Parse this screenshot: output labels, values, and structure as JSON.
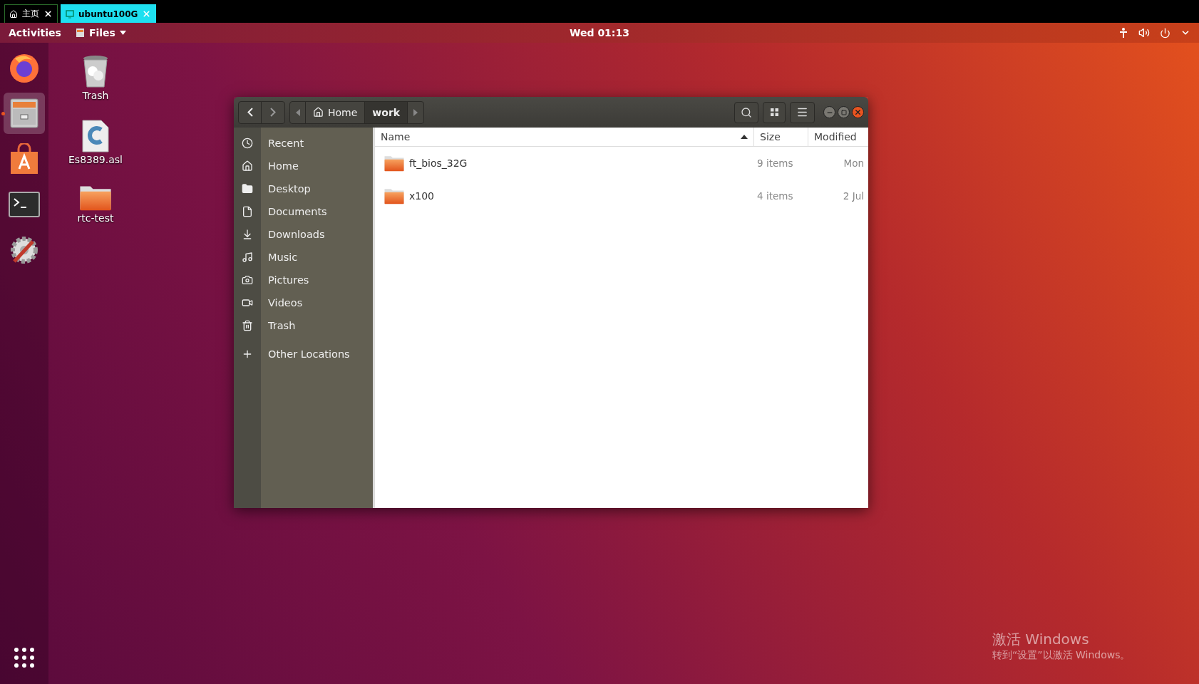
{
  "browser_tabs": [
    {
      "label": "主页",
      "selected": false
    },
    {
      "label": "ubuntu100G",
      "selected": true
    }
  ],
  "top_bar": {
    "activities": "Activities",
    "app_menu": "Files",
    "clock": "Wed 01:13"
  },
  "dock": {
    "items": [
      {
        "kind": "browser",
        "selected": false,
        "running": false
      },
      {
        "kind": "files",
        "selected": true,
        "running": true
      },
      {
        "kind": "software",
        "selected": false,
        "running": false
      },
      {
        "kind": "terminal",
        "selected": false,
        "running": false
      },
      {
        "kind": "settings",
        "selected": false,
        "running": false
      }
    ]
  },
  "desktop_icons": [
    {
      "kind": "trash",
      "label": "Trash"
    },
    {
      "kind": "document",
      "label": "Es8389.asl"
    },
    {
      "kind": "folder",
      "label": "rtc-test"
    }
  ],
  "window": {
    "path": [
      {
        "label": "Home",
        "selected": false
      },
      {
        "label": "work",
        "selected": true
      }
    ],
    "sidebar": {
      "items": [
        {
          "kind": "recent",
          "label": "Recent"
        },
        {
          "kind": "home",
          "label": "Home"
        },
        {
          "kind": "desktop",
          "label": "Desktop"
        },
        {
          "kind": "documents",
          "label": "Documents"
        },
        {
          "kind": "downloads",
          "label": "Downloads"
        },
        {
          "kind": "music",
          "label": "Music"
        },
        {
          "kind": "pictures",
          "label": "Pictures"
        },
        {
          "kind": "videos",
          "label": "Videos"
        },
        {
          "kind": "trash",
          "label": "Trash"
        }
      ],
      "other": {
        "label": "Other Locations"
      }
    },
    "table": {
      "columns": [
        {
          "label": "Name",
          "sorted": true
        },
        {
          "label": "Size",
          "sorted": false
        },
        {
          "label": "Modified",
          "sorted": false
        }
      ],
      "rows": [
        {
          "name": "ft_bios_32G",
          "size": "9 items",
          "modified": "Mon"
        },
        {
          "name": "x100",
          "size": "4 items",
          "modified": "2 Jul"
        }
      ]
    }
  },
  "activation_notice": {
    "title": "激活 Windows",
    "subtitle": "转到“设置”以激活 Windows。"
  }
}
